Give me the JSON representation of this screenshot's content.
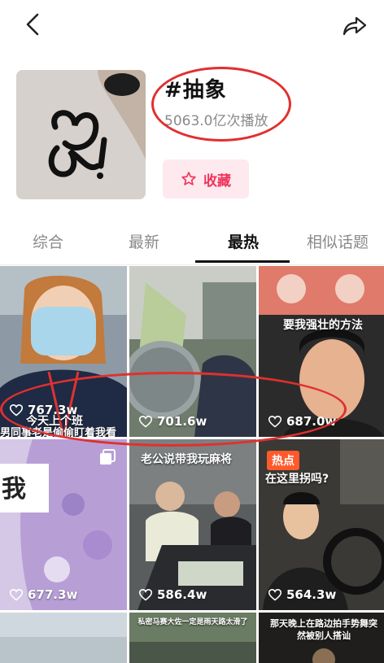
{
  "topic": {
    "title": "#抽象",
    "play_count": "5063.0亿次播放",
    "favorite_label": "收藏"
  },
  "tabs": [
    {
      "label": "综合",
      "active": false
    },
    {
      "label": "最新",
      "active": false
    },
    {
      "label": "最热",
      "active": true
    },
    {
      "label": "相似话题",
      "active": false
    }
  ],
  "videos": [
    {
      "caption": "今天上个班",
      "subcaption": "男同事老是偷偷盯着我看",
      "likes": "767.3w"
    },
    {
      "caption": "",
      "likes": "701.6w"
    },
    {
      "caption": "要我强壮的方法",
      "likes": "687.0w"
    },
    {
      "caption": "我",
      "likes": "677.3w"
    },
    {
      "caption": "老公说带我玩麻将",
      "likes": "586.4w"
    },
    {
      "caption": "在这里拐吗?",
      "badge": "热点",
      "likes": "564.3w"
    },
    {
      "caption": "",
      "likes": ""
    },
    {
      "caption": "私密马赛大佐一定是雨天路太滑了",
      "likes": ""
    },
    {
      "caption": "那天晚上在路边拍手势舞突然被别人搭讪",
      "likes": ""
    }
  ],
  "colors": {
    "accent": "#f0345c",
    "annotation": "#e0302f"
  }
}
